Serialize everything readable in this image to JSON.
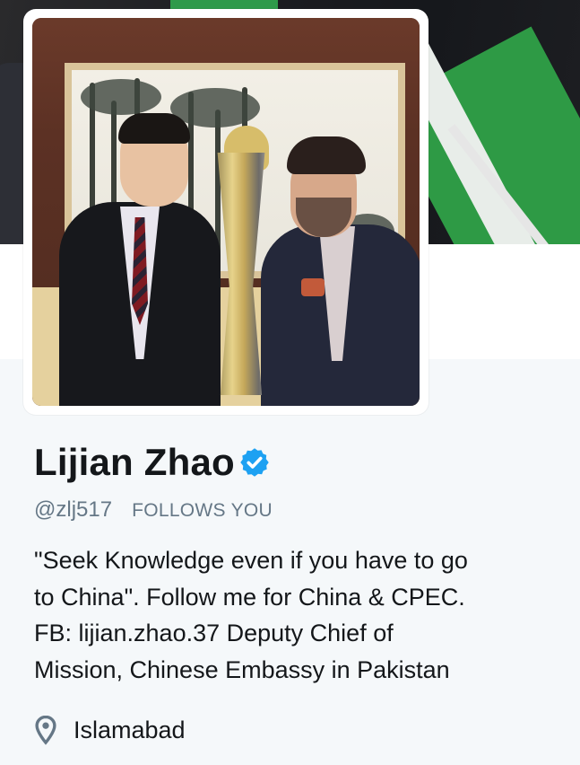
{
  "profile": {
    "name": "Lijian Zhao",
    "handle": "@zlj517",
    "follows_badge": "FOLLOWS YOU",
    "bio_lines": [
      "\"Seek Knowledge even if you have to go",
      "to China\". Follow me for China & CPEC.",
      "FB: lijian.zhao.37 Deputy Chief of",
      "Mission, Chinese Embassy in Pakistan"
    ],
    "location": "Islamabad",
    "verified": true
  },
  "icons": {
    "verified": "verified-badge-icon",
    "location": "location-pin-icon"
  },
  "colors": {
    "verified_blue": "#1da1f2",
    "secondary_text": "#657786",
    "primary_text": "#14171a",
    "page_bg": "#f5f8fa"
  }
}
